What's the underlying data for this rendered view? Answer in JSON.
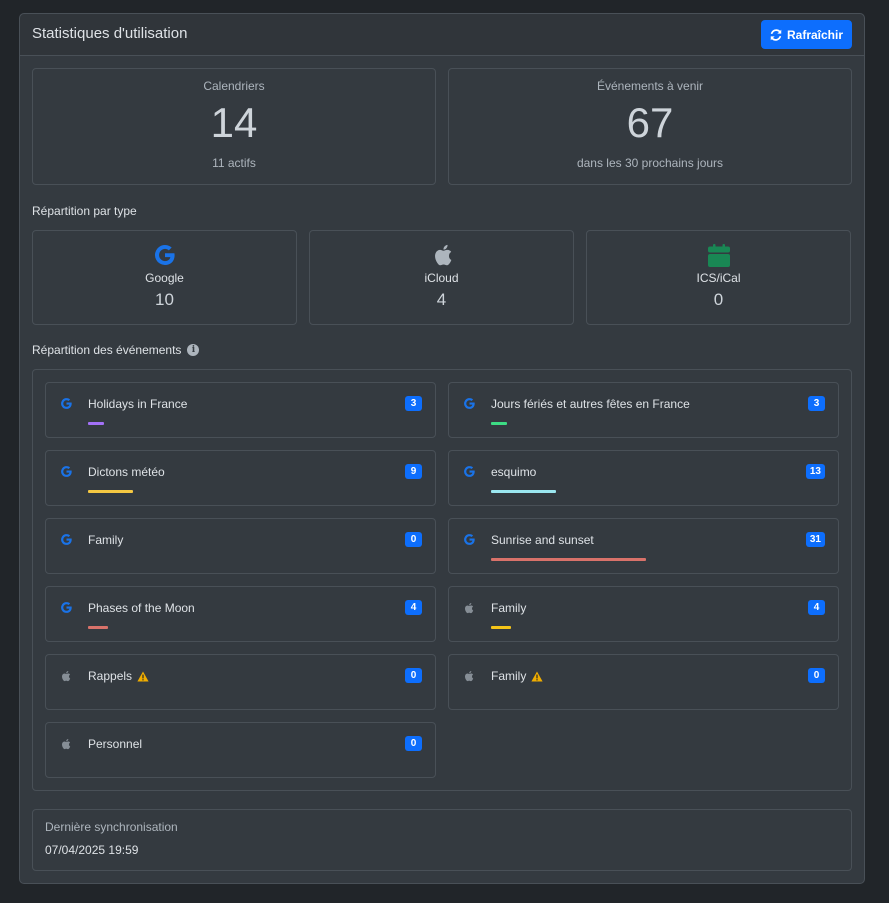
{
  "header": {
    "title": "Statistiques d'utilisation",
    "refresh_label": "Rafraîchir"
  },
  "stats": [
    {
      "label": "Calendriers",
      "value": "14",
      "sub": "11 actifs"
    },
    {
      "label": "Événements à venir",
      "value": "67",
      "sub": "dans les 30 prochains jours"
    }
  ],
  "types_section": {
    "title": "Répartition par type"
  },
  "types": [
    {
      "label": "Google",
      "count": "10",
      "icon": "google-icon"
    },
    {
      "label": "iCloud",
      "count": "4",
      "icon": "apple-icon"
    },
    {
      "label": "ICS/iCal",
      "count": "0",
      "icon": "calendar-icon"
    }
  ],
  "events_section": {
    "title": "Répartition des événements"
  },
  "events": [
    {
      "name": "Holidays in France",
      "count": "3",
      "source": "google",
      "color": "#a371f7",
      "bar_fraction": 0.1,
      "warning": false
    },
    {
      "name": "Jours fériés et autres fêtes en France",
      "count": "3",
      "source": "google",
      "color": "#3ddc84",
      "bar_fraction": 0.1,
      "warning": false
    },
    {
      "name": "Dictons météo",
      "count": "9",
      "source": "google",
      "color": "#f5c842",
      "bar_fraction": 0.29,
      "warning": false
    },
    {
      "name": "esquimo",
      "count": "13",
      "source": "google",
      "color": "#9be7f0",
      "bar_fraction": 0.42,
      "warning": false
    },
    {
      "name": "Family",
      "count": "0",
      "source": "google",
      "color": "#dee2e6",
      "bar_fraction": 0,
      "warning": false
    },
    {
      "name": "Sunrise and sunset",
      "count": "31",
      "source": "google",
      "color": "#d9726a",
      "bar_fraction": 1.0,
      "warning": false
    },
    {
      "name": "Phases of the Moon",
      "count": "4",
      "source": "google",
      "color": "#d9726a",
      "bar_fraction": 0.13,
      "warning": false
    },
    {
      "name": "Family",
      "count": "4",
      "source": "apple",
      "color": "#f5c518",
      "bar_fraction": 0.13,
      "warning": false
    },
    {
      "name": "Rappels",
      "count": "0",
      "source": "apple",
      "color": "#dee2e6",
      "bar_fraction": 0,
      "warning": true
    },
    {
      "name": "Family",
      "count": "0",
      "source": "apple",
      "color": "#dee2e6",
      "bar_fraction": 0,
      "warning": true
    },
    {
      "name": "Personnel",
      "count": "0",
      "source": "apple",
      "color": "#dee2e6",
      "bar_fraction": 0,
      "warning": false
    }
  ],
  "sync": {
    "label": "Dernière synchronisation",
    "value": "07/04/2025 19:59"
  },
  "colors": {
    "accent": "#0d6efd",
    "google_blue": "#1a73e8",
    "ics_green": "#198754",
    "warning": "#f0ad00"
  }
}
